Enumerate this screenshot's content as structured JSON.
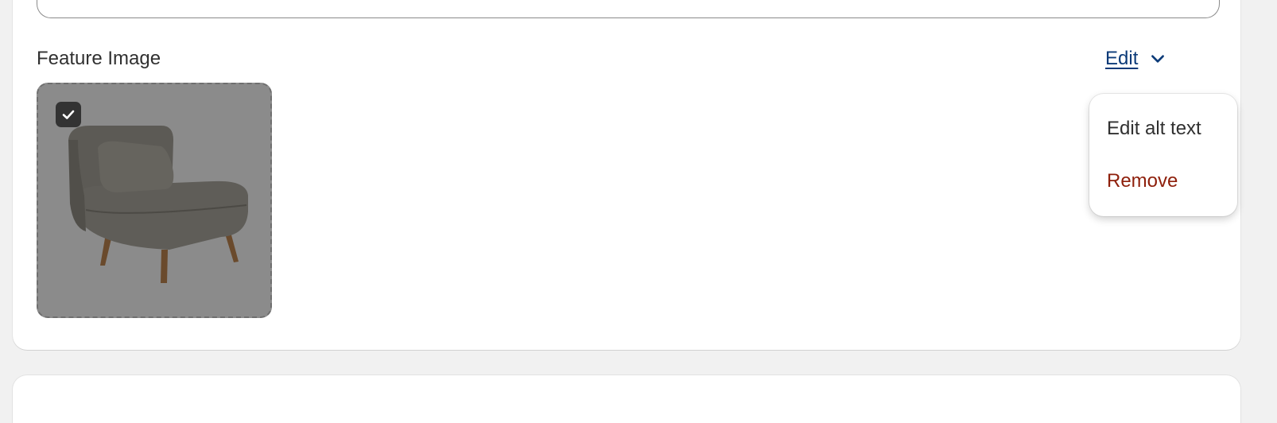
{
  "section": {
    "title": "Feature Image",
    "edit_label": "Edit"
  },
  "image": {
    "alt": "Grey upholstered chair with wooden legs",
    "selected": true
  },
  "menu": {
    "items": [
      {
        "label": "Edit alt text",
        "color": "#303030"
      },
      {
        "label": "Remove",
        "color": "#8e1f0b"
      }
    ]
  },
  "colors": {
    "link": "#0b3a78",
    "destructive": "#8e1f0b",
    "page_bg": "#f1f1f1"
  },
  "icons": {
    "chevron": "chevron-down-icon",
    "check": "check-icon"
  }
}
